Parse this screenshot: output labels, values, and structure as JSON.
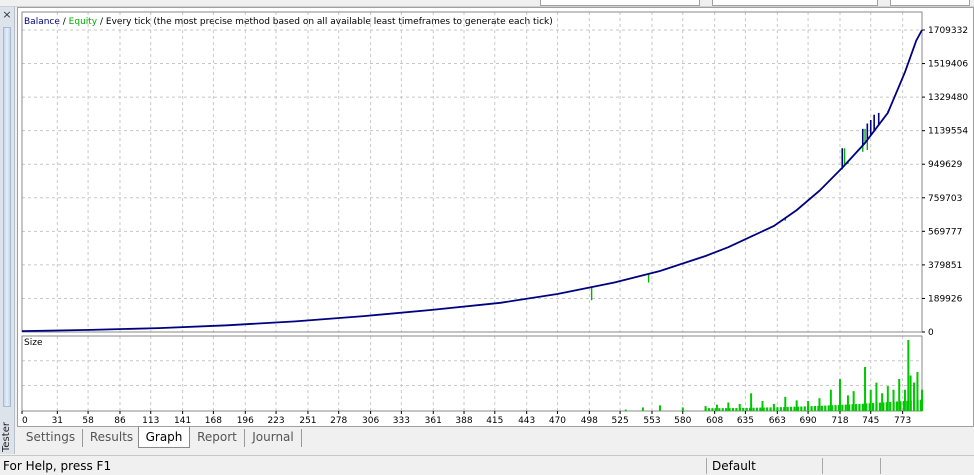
{
  "legend": {
    "balance": "Balance",
    "sep1": " / ",
    "equity": "Equity",
    "sep2": " / ",
    "description": "Every tick (the most precise method based on all available least timeframes to generate each tick)"
  },
  "colors": {
    "balance": "#000080",
    "equity": "#00b000",
    "grid": "#c8c8c8",
    "volume": "#00c800"
  },
  "chart_data": {
    "type": "line",
    "title": "",
    "xlabel": "",
    "ylabel": "",
    "x_ticks": [
      0,
      31,
      58,
      86,
      113,
      141,
      168,
      196,
      223,
      251,
      278,
      306,
      333,
      361,
      388,
      415,
      443,
      470,
      498,
      525,
      553,
      580,
      608,
      635,
      663,
      690,
      718,
      745,
      773
    ],
    "y_ticks": [
      0,
      189926,
      379851,
      569777,
      759703,
      949629,
      1139554,
      1329480,
      1519406,
      1709332
    ],
    "xlim": [
      0,
      790
    ],
    "ylim": [
      0,
      1709332
    ],
    "series": [
      {
        "name": "Balance",
        "x": [
          0,
          60,
          120,
          180,
          240,
          300,
          360,
          420,
          470,
          520,
          560,
          600,
          620,
          640,
          660,
          680,
          700,
          720,
          740,
          760,
          775,
          780,
          785,
          790
        ],
        "y": [
          5000,
          12000,
          22000,
          38000,
          60000,
          90000,
          125000,
          165000,
          215000,
          280000,
          345000,
          430000,
          480000,
          540000,
          600000,
          690000,
          800000,
          930000,
          1070000,
          1240000,
          1470000,
          1560000,
          1650000,
          1709332
        ]
      },
      {
        "name": "Equity",
        "x": [
          500,
          550,
          556,
          620,
          632,
          670,
          720,
          722,
          725,
          738,
          740,
          742,
          748,
          755,
          760
        ],
        "y": [
          180000,
          280000,
          340000,
          480000,
          515000,
          630000,
          920000,
          1040000,
          950000,
          1020000,
          1150000,
          1030000,
          1180000,
          1200000,
          1250000
        ]
      }
    ],
    "volume_panel": {
      "label": "Size",
      "x": [
        530,
        545,
        560,
        580,
        600,
        610,
        620,
        630,
        640,
        650,
        660,
        670,
        680,
        690,
        700,
        710,
        718,
        725,
        730,
        740,
        745,
        750,
        755,
        760,
        765,
        770,
        775,
        778,
        780,
        783,
        786,
        790
      ],
      "y": [
        0.02,
        0.05,
        0.08,
        0.05,
        0.07,
        0.09,
        0.12,
        0.1,
        0.25,
        0.14,
        0.1,
        0.2,
        0.15,
        0.14,
        0.18,
        0.3,
        0.45,
        0.22,
        0.28,
        0.62,
        0.3,
        0.4,
        0.25,
        0.35,
        0.3,
        0.45,
        0.3,
        1.0,
        0.5,
        0.4,
        0.55,
        0.3
      ]
    }
  },
  "tabs": [
    {
      "label": "Settings",
      "active": false
    },
    {
      "label": "Results",
      "active": false
    },
    {
      "label": "Graph",
      "active": true
    },
    {
      "label": "Report",
      "active": false
    },
    {
      "label": "Journal",
      "active": false
    }
  ],
  "sidebar": {
    "label": "Tester",
    "close": "×"
  },
  "status": {
    "help": "For Help, press F1",
    "profile": "Default"
  }
}
